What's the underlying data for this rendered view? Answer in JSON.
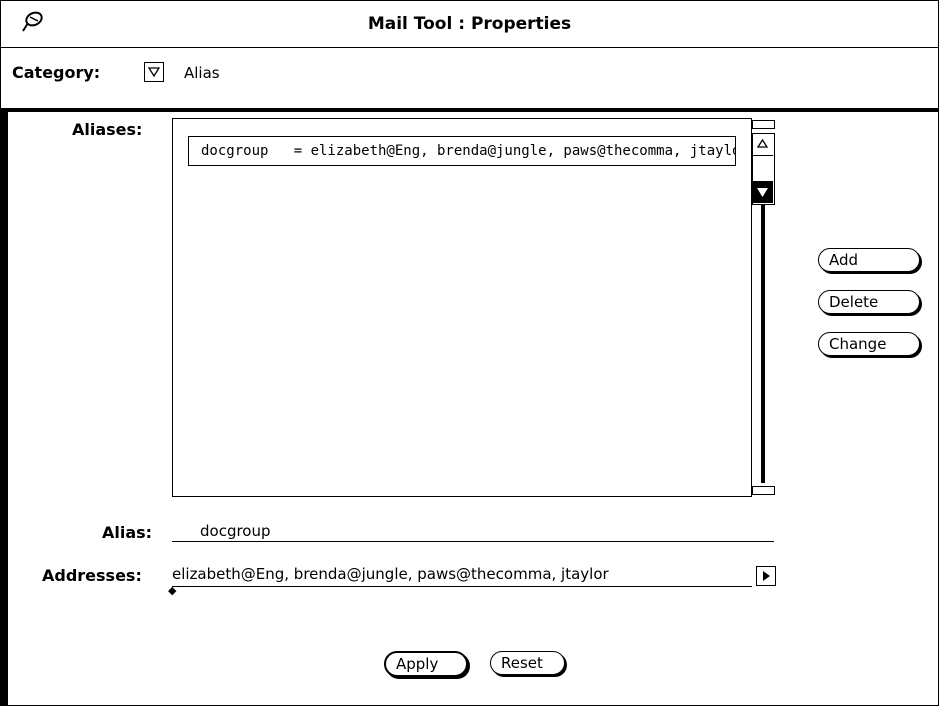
{
  "window": {
    "title": "Mail Tool  : Properties",
    "menu_icon": "pushpin-icon"
  },
  "category": {
    "label": "Category:",
    "value": "Alias",
    "button_icon": "triangle-down-icon"
  },
  "aliases": {
    "label": "Aliases:",
    "items": [
      "docgroup   = elizabeth@Eng, brenda@jungle, paws@thecomma, jtaylor"
    ]
  },
  "scrollbar": {
    "up_icon": "triangle-up-icon",
    "down_icon": "triangle-down-icon"
  },
  "actions": {
    "add": "Add",
    "delete": "Delete",
    "change": "Change"
  },
  "alias_field": {
    "label": "Alias:",
    "value": "docgroup"
  },
  "addresses_field": {
    "label": "Addresses:",
    "value": "elizabeth@Eng, brenda@jungle, paws@thecomma, jtaylor",
    "scroll_icon": "triangle-right-icon"
  },
  "footer": {
    "apply": "Apply",
    "reset": "Reset"
  }
}
